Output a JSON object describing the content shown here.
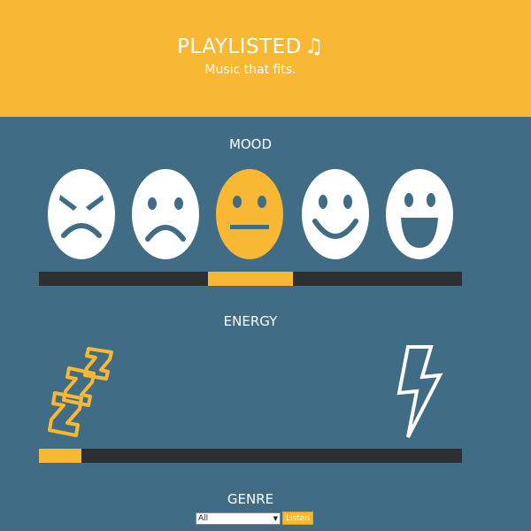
{
  "header": {
    "title": "PLAYLISTED",
    "note_glyph": "♫",
    "tagline": "Music that fits.",
    "color": "#f8b833"
  },
  "mood": {
    "title": "MOOD",
    "faces": [
      {
        "icon": "angry-face-icon",
        "selected": false
      },
      {
        "icon": "sad-face-icon",
        "selected": false
      },
      {
        "icon": "neutral-face-icon",
        "selected": true
      },
      {
        "icon": "happy-face-icon",
        "selected": false
      },
      {
        "icon": "very-happy-face-icon",
        "selected": false
      }
    ],
    "selected_index": 2,
    "slider_range": [
      0.4,
      0.6
    ]
  },
  "energy": {
    "title": "ENERGY",
    "low_icon": "sleep-zzz-icon",
    "high_icon": "lightning-bolt-icon",
    "slider_fraction": 0.1
  },
  "genre": {
    "title": "GENRE",
    "selected": "All",
    "listen_label": "Listen"
  },
  "colors": {
    "background": "#416c85",
    "accent": "#f8b833",
    "track": "#2d2f31"
  }
}
